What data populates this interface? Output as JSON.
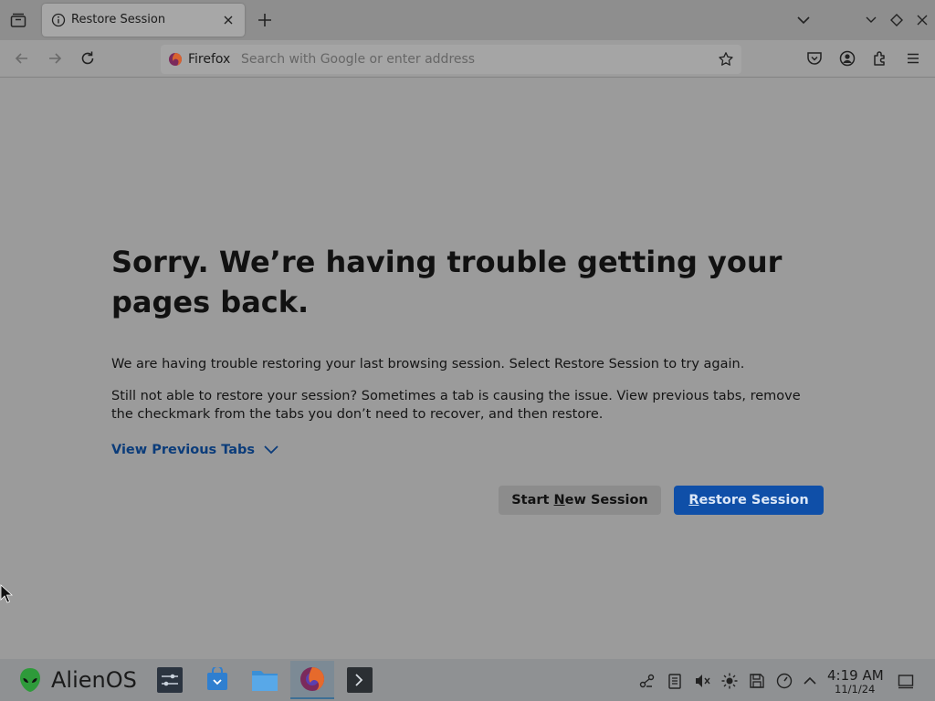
{
  "browser": {
    "tab": {
      "title": "Restore Session"
    },
    "identity_label": "Firefox",
    "url_placeholder": "Search with Google or enter address"
  },
  "page": {
    "title": "Sorry. We’re having trouble getting your pages back.",
    "paragraph1": "We are having trouble restoring your last browsing session. Select Restore Session to try again.",
    "paragraph2": "Still not able to restore your session? Sometimes a tab is causing the issue. View previous tabs, remove the checkmark from the tabs you don’t need to recover, and then restore.",
    "view_previous_tabs": "View Previous Tabs",
    "start_new_session": {
      "before": "Start ",
      "underline": "N",
      "after": "ew Session"
    },
    "restore_session": {
      "underline": "R",
      "after": "estore Session"
    }
  },
  "taskbar": {
    "start_label": "AlienOS",
    "clock_time": "4:19 AM",
    "clock_date": "11/1/24"
  },
  "colors": {
    "primary_button": "#0f4fa8",
    "link": "#0b3c7a"
  }
}
